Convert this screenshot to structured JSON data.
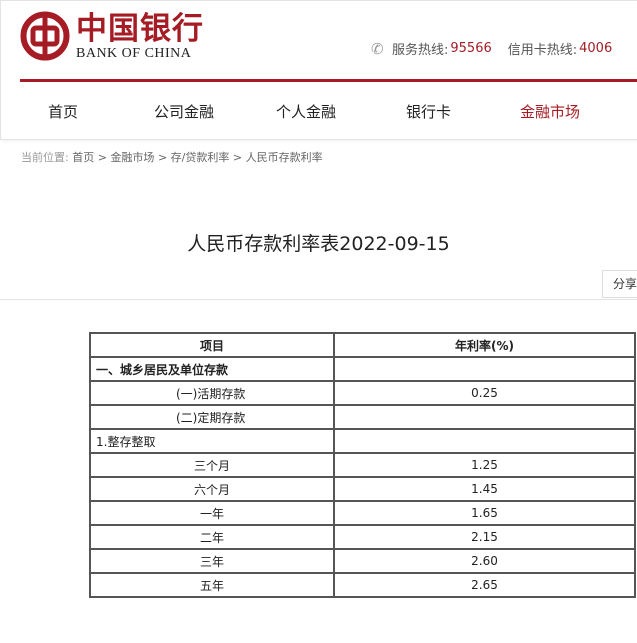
{
  "header": {
    "logo_cn": "中国银行",
    "logo_en": "BANK OF CHINA",
    "service_label": "服务热线:",
    "service_number": "95566",
    "card_label": "信用卡热线:",
    "card_number": "4006",
    "accent_color": "#a51c24"
  },
  "nav": {
    "items": [
      {
        "label": "首页"
      },
      {
        "label": "公司金融"
      },
      {
        "label": "个人金融"
      },
      {
        "label": "银行卡"
      },
      {
        "label": "金融市场"
      }
    ]
  },
  "breadcrumb": {
    "label": "当前位置:",
    "items": [
      "首页",
      "金融市场",
      "存/贷款利率",
      "人民币存款利率"
    ],
    "separator": ">"
  },
  "page": {
    "title": "人民币存款利率表2022-09-15",
    "share_label": "分享"
  },
  "table": {
    "headers": [
      "项目",
      "年利率(%)"
    ],
    "rows": [
      {
        "item": "一、城乡居民及单位存款",
        "rate": ""
      },
      {
        "item": "(一)活期存款",
        "rate": "0.25"
      },
      {
        "item": "(二)定期存款",
        "rate": ""
      },
      {
        "item": "1.整存整取",
        "rate": ""
      },
      {
        "item": "三个月",
        "rate": "1.25"
      },
      {
        "item": "六个月",
        "rate": "1.45"
      },
      {
        "item": "一年",
        "rate": "1.65"
      },
      {
        "item": "二年",
        "rate": "2.15"
      },
      {
        "item": "三年",
        "rate": "2.60"
      },
      {
        "item": "五年",
        "rate": "2.65"
      }
    ]
  }
}
